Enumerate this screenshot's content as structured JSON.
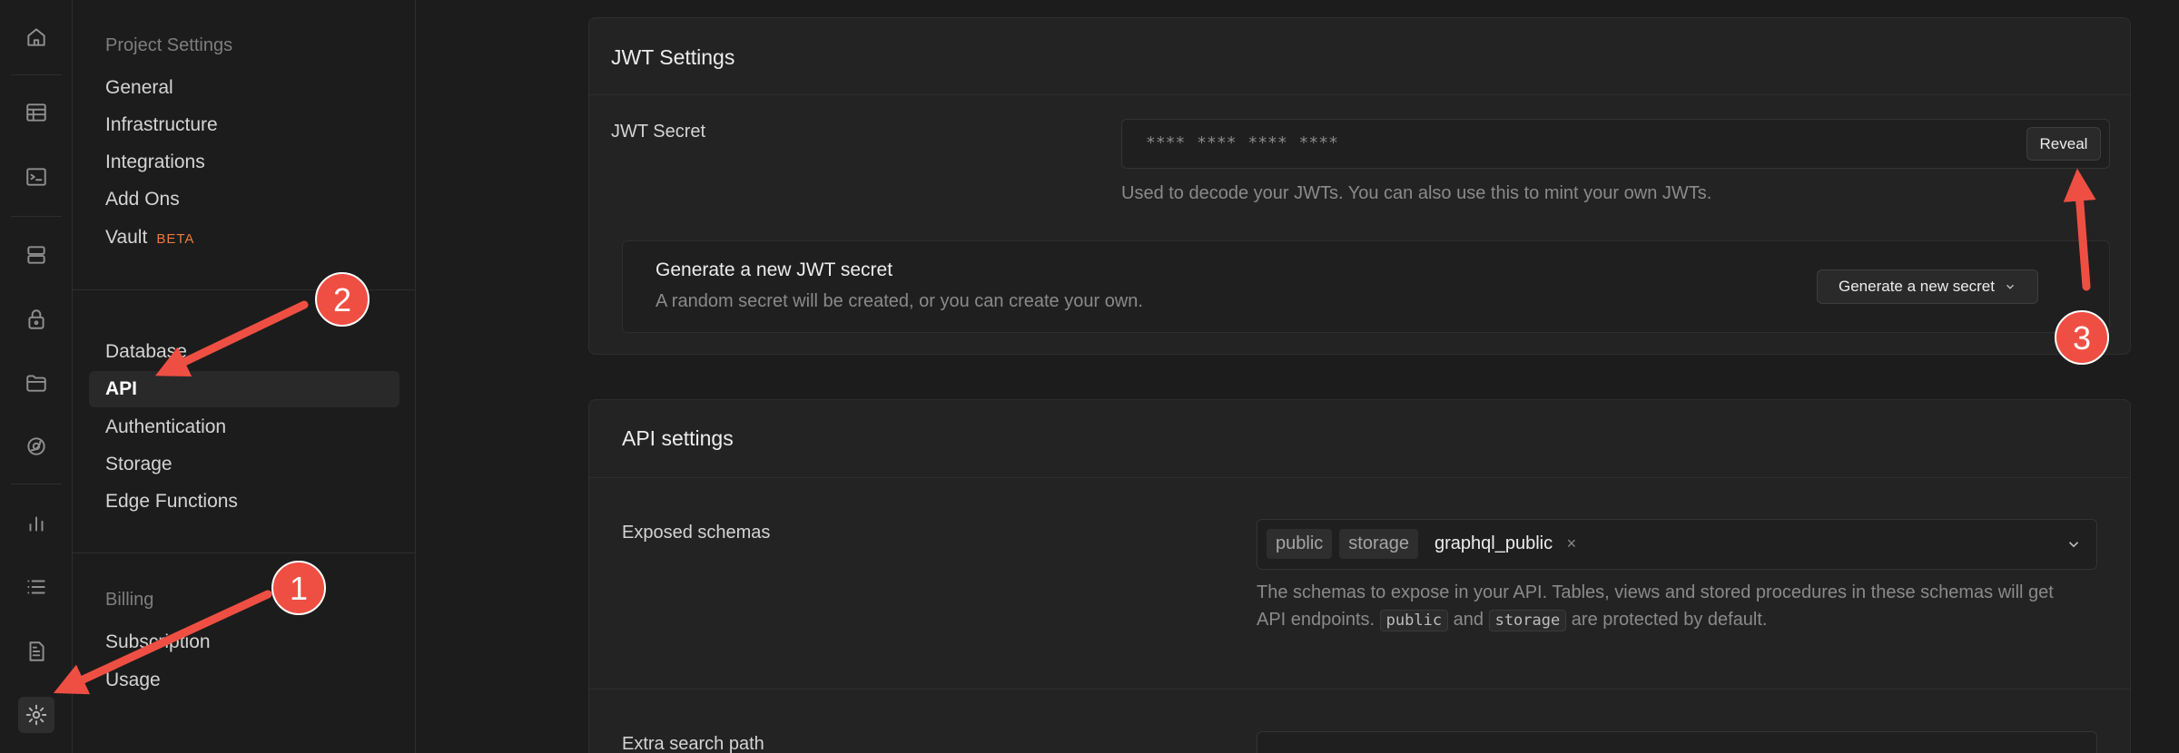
{
  "rail": {
    "icons": [
      "home-icon",
      "table-editor-icon",
      "sql-editor-icon",
      "database-icon",
      "auth-lock-icon",
      "storage-icon",
      "edge-functions-icon",
      "reports-icon",
      "logs-icon",
      "docs-icon",
      "settings-icon"
    ]
  },
  "menu": {
    "project_settings_title": "Project Settings",
    "project_items": [
      "General",
      "Infrastructure",
      "Integrations",
      "Add Ons",
      "Vault"
    ],
    "vault_badge": "BETA",
    "config_items": [
      "Database",
      "API",
      "Authentication",
      "Storage",
      "Edge Functions"
    ],
    "billing_title": "Billing",
    "billing_items": [
      "Subscription",
      "Usage"
    ]
  },
  "jwt": {
    "title": "JWT Settings",
    "secret_label": "JWT Secret",
    "secret_masked": "**** **** **** ****",
    "reveal_label": "Reveal",
    "secret_help": "Used to decode your JWTs. You can also use this to mint your own JWTs.",
    "generate_title": "Generate a new JWT secret",
    "generate_desc": "A random secret will be created, or you can create your own.",
    "generate_button": "Generate a new secret"
  },
  "api": {
    "title": "API settings",
    "schemas_label": "Exposed schemas",
    "schemas": [
      "public",
      "storage",
      "graphql_public"
    ],
    "schemas_help_1": "The schemas to expose in your API. Tables, views and stored procedures in these schemas will get",
    "schemas_help_2a": "API endpoints.",
    "schemas_help_code1": "public",
    "schemas_help_and": "and",
    "schemas_help_code2": "storage",
    "schemas_help_2b": "are protected by default.",
    "extra_search_label": "Extra search path"
  },
  "annotations": {
    "badges": [
      "1",
      "2",
      "3"
    ],
    "color": "#ef4f43"
  }
}
